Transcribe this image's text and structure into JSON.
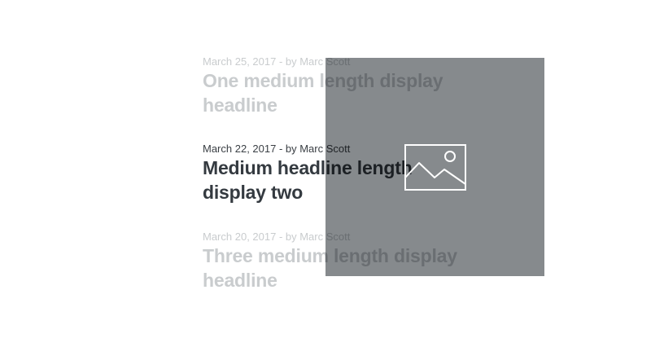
{
  "articles": [
    {
      "meta": "March 25, 2017 - by Marc Scott",
      "headline": "One medium length display headline",
      "state": "inactive"
    },
    {
      "meta": "March 22, 2017 - by Marc Scott",
      "headline": "Medium headline length display two",
      "state": "active"
    },
    {
      "meta": "March 20, 2017 - by Marc Scott",
      "headline": "Three medium length display headline",
      "state": "inactive"
    }
  ],
  "image_placeholder": {
    "icon": "image-icon",
    "color": "#868a8d"
  },
  "colors": {
    "active_text": "#343a40",
    "inactive_text": "#c9ccce",
    "background": "#ffffff"
  }
}
